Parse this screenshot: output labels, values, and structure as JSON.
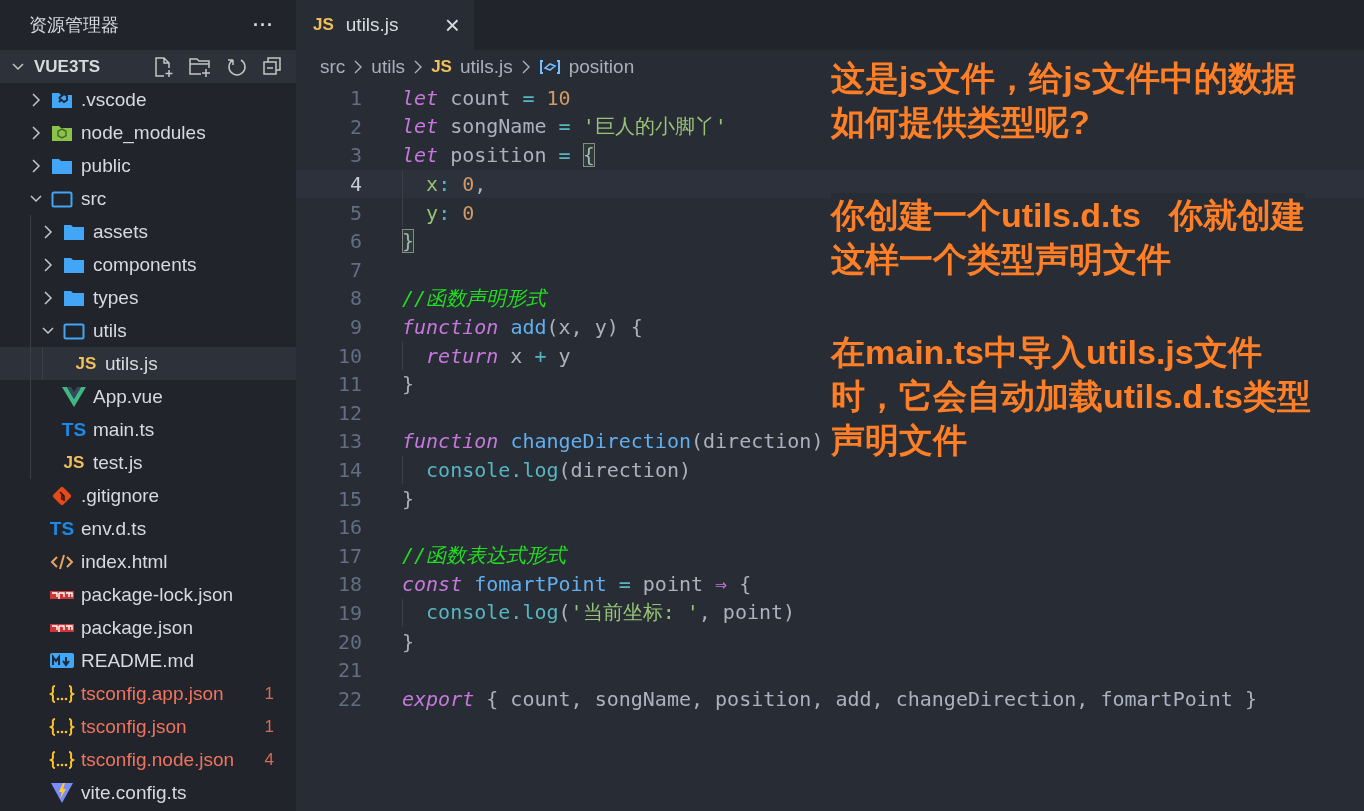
{
  "sidebar": {
    "title": "资源管理器",
    "more": "···",
    "project": {
      "name": "VUE3TS",
      "expanded": true
    },
    "tree": [
      {
        "name": ".vscode",
        "kind": "folder-vscode",
        "expanded": false,
        "selected": false,
        "error": false
      },
      {
        "name": "node_modules",
        "kind": "folder-node",
        "expanded": false,
        "selected": false,
        "error": false
      },
      {
        "name": "public",
        "kind": "folder",
        "expanded": false,
        "selected": false,
        "error": false
      },
      {
        "name": "src",
        "kind": "folder",
        "expanded": true,
        "selected": false,
        "error": false,
        "children": [
          {
            "name": "assets",
            "kind": "folder",
            "expanded": false,
            "selected": false,
            "error": false
          },
          {
            "name": "components",
            "kind": "folder",
            "expanded": false,
            "selected": false,
            "error": false
          },
          {
            "name": "types",
            "kind": "folder",
            "expanded": false,
            "selected": false,
            "error": false
          },
          {
            "name": "utils",
            "kind": "folder",
            "expanded": true,
            "selected": false,
            "error": false,
            "children": [
              {
                "name": "utils.js",
                "kind": "js",
                "icon_label": "JS",
                "selected": true,
                "error": false
              }
            ]
          },
          {
            "name": "App.vue",
            "kind": "vue",
            "selected": false,
            "error": false
          },
          {
            "name": "main.ts",
            "kind": "ts",
            "icon_label": "TS",
            "selected": false,
            "error": false
          },
          {
            "name": "test.js",
            "kind": "js",
            "icon_label": "JS",
            "selected": false,
            "error": false
          }
        ]
      },
      {
        "name": ".gitignore",
        "kind": "git",
        "selected": false,
        "error": false
      },
      {
        "name": "env.d.ts",
        "kind": "ts",
        "icon_label": "TS",
        "selected": false,
        "error": false
      },
      {
        "name": "index.html",
        "kind": "html",
        "selected": false,
        "error": false
      },
      {
        "name": "package-lock.json",
        "kind": "npm",
        "selected": false,
        "error": false
      },
      {
        "name": "package.json",
        "kind": "npm",
        "selected": false,
        "error": false
      },
      {
        "name": "README.md",
        "kind": "md",
        "selected": false,
        "error": false
      },
      {
        "name": "tsconfig.app.json",
        "kind": "json",
        "selected": false,
        "error": true,
        "badge": "1"
      },
      {
        "name": "tsconfig.json",
        "kind": "json",
        "selected": false,
        "error": true,
        "badge": "1"
      },
      {
        "name": "tsconfig.node.json",
        "kind": "json",
        "selected": false,
        "error": true,
        "badge": "4"
      },
      {
        "name": "vite.config.ts",
        "kind": "vite",
        "selected": false,
        "error": false
      }
    ]
  },
  "tabs": [
    {
      "label": "utils.js",
      "kind": "js",
      "icon_label": "JS",
      "selected": true,
      "close": "×"
    }
  ],
  "breadcrumb": [
    {
      "label": "src",
      "kind": "plain"
    },
    {
      "label": "utils",
      "kind": "plain"
    },
    {
      "label": "utils.js",
      "kind": "js",
      "icon_label": "JS"
    },
    {
      "label": "position",
      "kind": "variable"
    }
  ],
  "editor": {
    "lines": [
      {
        "number": "1",
        "current": false,
        "tokens": [
          {
            "kind": "keyword",
            "text": "let"
          },
          {
            "kind": "plain",
            "text": " count "
          },
          {
            "kind": "op",
            "text": "="
          },
          {
            "kind": "num",
            "text": " 10"
          }
        ]
      },
      {
        "number": "2",
        "current": false,
        "tokens": [
          {
            "kind": "keyword",
            "text": "let"
          },
          {
            "kind": "plain",
            "text": " songName "
          },
          {
            "kind": "op",
            "text": "="
          },
          {
            "kind": "str",
            "text": " '巨人的小脚丫'"
          }
        ]
      },
      {
        "number": "3",
        "current": false,
        "tokens": [
          {
            "kind": "keyword",
            "text": "let"
          },
          {
            "kind": "plain",
            "text": " position "
          },
          {
            "kind": "op",
            "text": "= "
          },
          {
            "kind": "match",
            "text": "{"
          }
        ]
      },
      {
        "number": "4",
        "current": true,
        "tokens": [
          {
            "kind": "prop",
            "text": "  x"
          },
          {
            "kind": "op",
            "text": ":"
          },
          {
            "kind": "num",
            "text": " 0"
          },
          {
            "kind": "plain",
            "text": ","
          }
        ]
      },
      {
        "number": "5",
        "current": false,
        "tokens": [
          {
            "kind": "prop",
            "text": "  y"
          },
          {
            "kind": "op",
            "text": ":"
          },
          {
            "kind": "num",
            "text": " 0"
          }
        ]
      },
      {
        "number": "6",
        "current": false,
        "tokens": [
          {
            "kind": "match",
            "text": "}"
          }
        ]
      },
      {
        "number": "7",
        "current": false
      },
      {
        "number": "8",
        "current": false,
        "tokens": [
          {
            "kind": "comment",
            "text": "//函数声明形式"
          }
        ]
      },
      {
        "number": "9",
        "current": false,
        "tokens": [
          {
            "kind": "keyword",
            "text": "function "
          },
          {
            "kind": "func",
            "text": "add"
          },
          {
            "kind": "plain",
            "text": "(x, y) {"
          }
        ]
      },
      {
        "number": "10",
        "current": false,
        "tokens": [
          {
            "kind": "keyword",
            "text": "  return"
          },
          {
            "kind": "plain",
            "text": " x "
          },
          {
            "kind": "op",
            "text": "+"
          },
          {
            "kind": "plain",
            "text": " y"
          }
        ]
      },
      {
        "number": "11",
        "current": false,
        "tokens": [
          {
            "kind": "plain",
            "text": "}"
          }
        ]
      },
      {
        "number": "12",
        "current": false
      },
      {
        "number": "13",
        "current": false,
        "tokens": [
          {
            "kind": "keyword",
            "text": "function "
          },
          {
            "kind": "func",
            "text": "changeDirection"
          },
          {
            "kind": "plain",
            "text": "(direction)"
          }
        ]
      },
      {
        "number": "14",
        "current": false,
        "tokens": [
          {
            "kind": "method",
            "text": "  console.log"
          },
          {
            "kind": "plain",
            "text": "(direction)"
          }
        ]
      },
      {
        "number": "15",
        "current": false,
        "tokens": [
          {
            "kind": "plain",
            "text": "}"
          }
        ]
      },
      {
        "number": "16",
        "current": false
      },
      {
        "number": "17",
        "current": false,
        "tokens": [
          {
            "kind": "comment",
            "text": "//函数表达式形式"
          }
        ]
      },
      {
        "number": "18",
        "current": false,
        "tokens": [
          {
            "kind": "keyword",
            "text": "const "
          },
          {
            "kind": "func",
            "text": "fomartPoint"
          },
          {
            "kind": "op",
            "text": " = "
          },
          {
            "kind": "plain",
            "text": "point "
          },
          {
            "kind": "keyword2",
            "text": "⇒"
          },
          {
            "kind": "plain",
            "text": " {"
          }
        ]
      },
      {
        "number": "19",
        "current": false,
        "tokens": [
          {
            "kind": "method",
            "text": "  console.log"
          },
          {
            "kind": "plain",
            "text": "("
          },
          {
            "kind": "str",
            "text": "'当前坐标: '"
          },
          {
            "kind": "plain",
            "text": ", point)"
          }
        ]
      },
      {
        "number": "20",
        "current": false,
        "tokens": [
          {
            "kind": "plain",
            "text": "}"
          }
        ]
      },
      {
        "number": "21",
        "current": false
      },
      {
        "number": "22",
        "current": false,
        "tokens": [
          {
            "kind": "keyword",
            "text": "export"
          },
          {
            "kind": "plain",
            "text": " { count, songName, position, add, changeDirection, fomartPoint }"
          }
        ]
      }
    ]
  },
  "annotation": {
    "paragraphs": [
      [
        "这是js文件，给js文件中的数据",
        "如何提供类型呢?"
      ],
      [
        "你创建一个utils.d.ts   你就创建",
        "这样一个类型声明文件"
      ],
      [
        "在main.ts中导入utils.js文件",
        "时，它会自动加载utils.d.ts类型",
        "声明文件"
      ]
    ]
  }
}
